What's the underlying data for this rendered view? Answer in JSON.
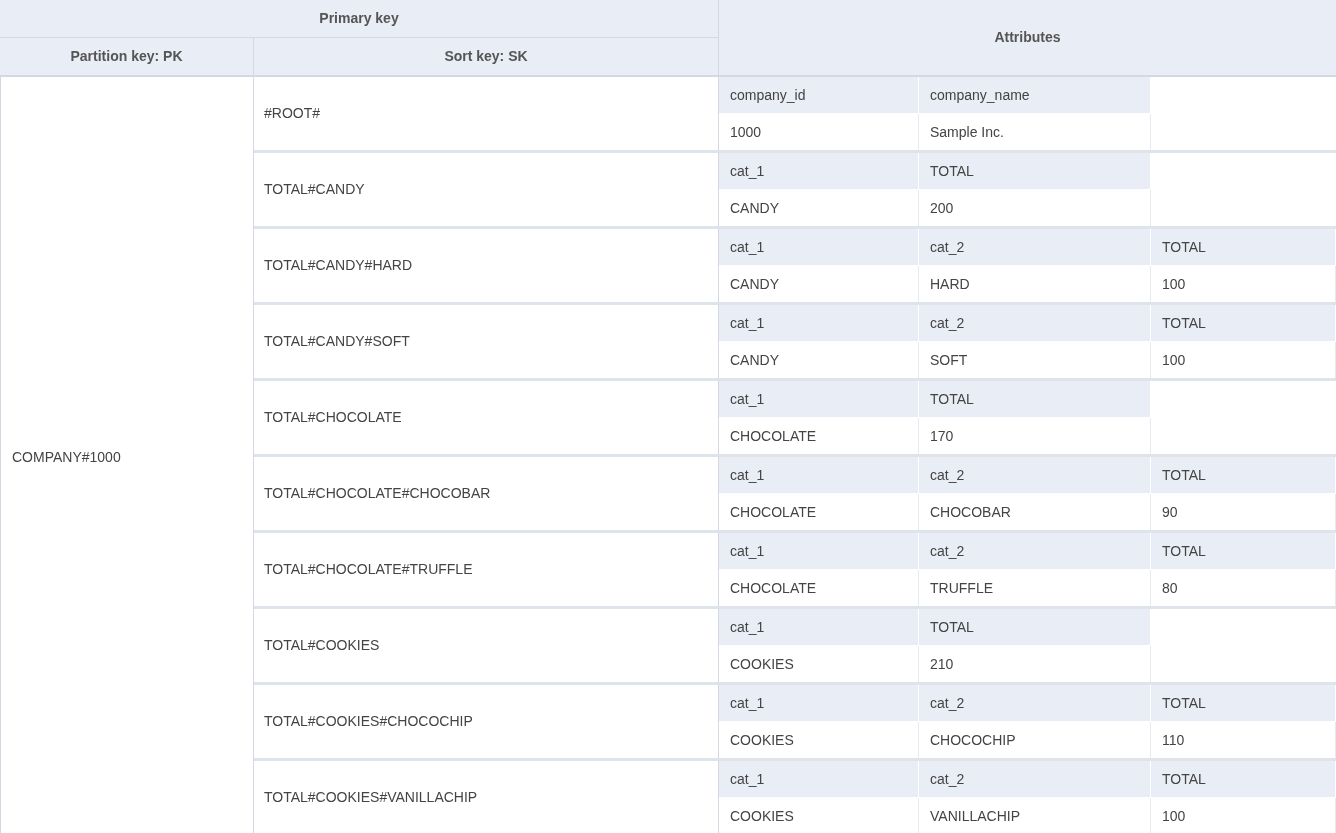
{
  "header": {
    "primary_key": "Primary key",
    "partition_key": "Partition key: PK",
    "sort_key": "Sort key: SK",
    "attributes": "Attributes"
  },
  "partition_value": "COMPANY#1000",
  "items": [
    {
      "sk": "#ROOT#",
      "attributes": [
        {
          "name": "company_id",
          "value": "1000"
        },
        {
          "name": "company_name",
          "value": "Sample Inc."
        }
      ]
    },
    {
      "sk": "TOTAL#CANDY",
      "attributes": [
        {
          "name": "cat_1",
          "value": "CANDY"
        },
        {
          "name": "TOTAL",
          "value": "200"
        }
      ]
    },
    {
      "sk": "TOTAL#CANDY#HARD",
      "attributes": [
        {
          "name": "cat_1",
          "value": "CANDY"
        },
        {
          "name": "cat_2",
          "value": "HARD"
        },
        {
          "name": "TOTAL",
          "value": "100"
        }
      ]
    },
    {
      "sk": "TOTAL#CANDY#SOFT",
      "attributes": [
        {
          "name": "cat_1",
          "value": "CANDY"
        },
        {
          "name": "cat_2",
          "value": "SOFT"
        },
        {
          "name": "TOTAL",
          "value": "100"
        }
      ]
    },
    {
      "sk": "TOTAL#CHOCOLATE",
      "attributes": [
        {
          "name": "cat_1",
          "value": "CHOCOLATE"
        },
        {
          "name": "TOTAL",
          "value": "170"
        }
      ]
    },
    {
      "sk": "TOTAL#CHOCOLATE#CHOCOBAR",
      "attributes": [
        {
          "name": "cat_1",
          "value": "CHOCOLATE"
        },
        {
          "name": "cat_2",
          "value": "CHOCOBAR"
        },
        {
          "name": "TOTAL",
          "value": "90"
        }
      ]
    },
    {
      "sk": "TOTAL#CHOCOLATE#TRUFFLE",
      "attributes": [
        {
          "name": "cat_1",
          "value": "CHOCOLATE"
        },
        {
          "name": "cat_2",
          "value": "TRUFFLE"
        },
        {
          "name": "TOTAL",
          "value": "80"
        }
      ]
    },
    {
      "sk": "TOTAL#COOKIES",
      "attributes": [
        {
          "name": "cat_1",
          "value": "COOKIES"
        },
        {
          "name": "TOTAL",
          "value": "210"
        }
      ]
    },
    {
      "sk": "TOTAL#COOKIES#CHOCOCHIP",
      "attributes": [
        {
          "name": "cat_1",
          "value": "COOKIES"
        },
        {
          "name": "cat_2",
          "value": "CHOCOCHIP"
        },
        {
          "name": "TOTAL",
          "value": "110"
        }
      ]
    },
    {
      "sk": "TOTAL#COOKIES#VANILLACHIP",
      "attributes": [
        {
          "name": "cat_1",
          "value": "COOKIES"
        },
        {
          "name": "cat_2",
          "value": "VANILLACHIP"
        },
        {
          "name": "TOTAL",
          "value": "100"
        }
      ]
    }
  ]
}
